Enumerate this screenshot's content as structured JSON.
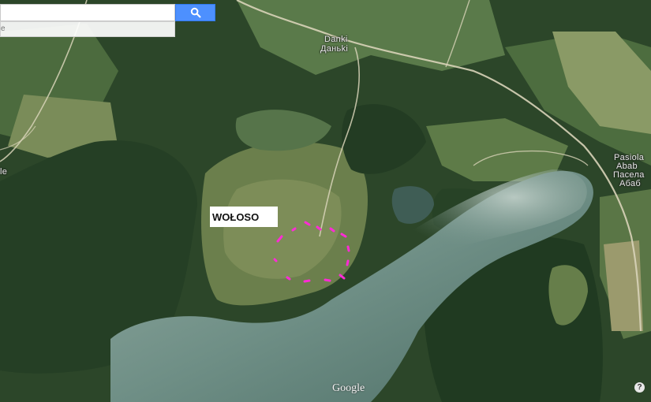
{
  "search": {
    "value": "",
    "placeholder": "",
    "button_icon": "search-icon",
    "suggestion_hint": "e"
  },
  "map": {
    "type": "satellite",
    "labels": {
      "danki_latin": "Danki",
      "danki_cyrillic": "Даньki",
      "pasiola_1": "Pasiola",
      "pasiola_2": "Abab",
      "pasiola_3": "Пасела",
      "pasiola_4": "Абаб",
      "left_edge": "le"
    },
    "marker_label": "WOŁOSO",
    "marker_color": "#ff2bd6",
    "road_color": "#d8d3b8",
    "water_color": "#6f8f86"
  },
  "footer": {
    "logo": "Google",
    "help": "?"
  }
}
